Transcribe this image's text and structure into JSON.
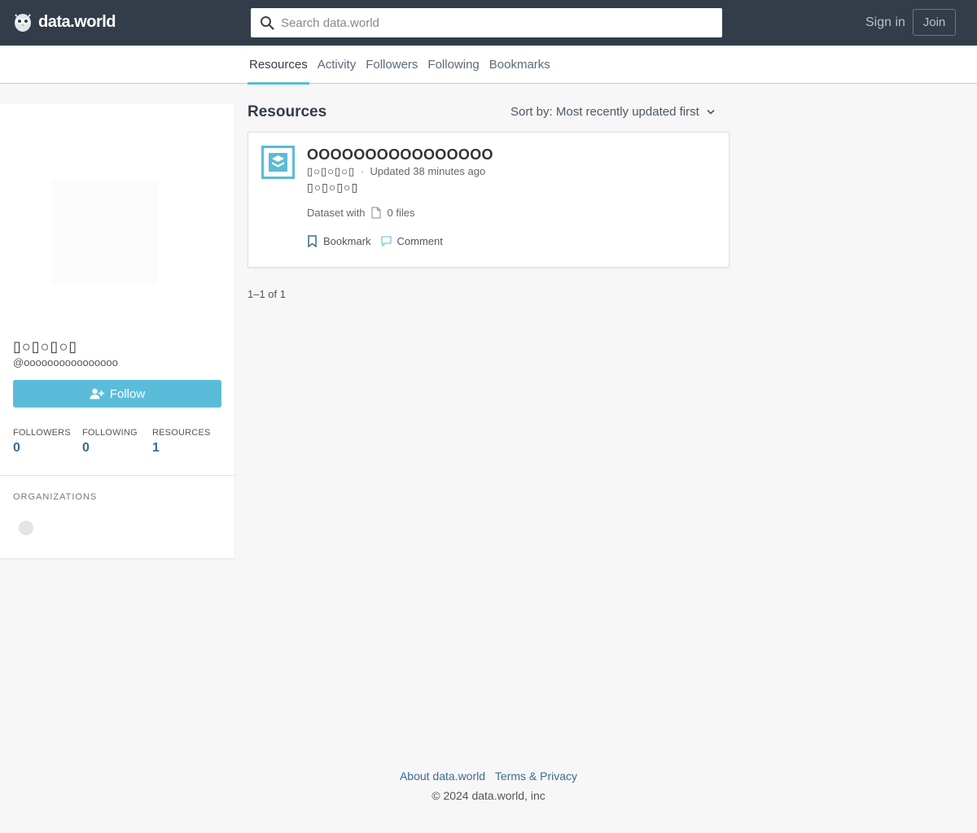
{
  "header": {
    "brand": "data.world",
    "search_placeholder": "Search data.world",
    "signin_label": "Sign in",
    "join_label": "Join"
  },
  "tabs": [
    {
      "label": "Resources",
      "active": true
    },
    {
      "label": "Activity",
      "active": false
    },
    {
      "label": "Followers",
      "active": false
    },
    {
      "label": "Following",
      "active": false
    },
    {
      "label": "Bookmarks",
      "active": false
    }
  ],
  "profile": {
    "display_name": "▯○▯○▯○▯",
    "username": "@oooooooooooooooo",
    "follow_label": "Follow",
    "stats": [
      {
        "label": "FOLLOWERS",
        "value": "0"
      },
      {
        "label": "FOLLOWING",
        "value": "0"
      },
      {
        "label": "RESOURCES",
        "value": "1"
      }
    ],
    "organizations_label": "ORGANIZATIONS"
  },
  "main": {
    "title": "Resources",
    "sort_label": "Sort by: Most recently updated first",
    "card": {
      "title": "OOOOOOOOOOOOOOOO",
      "owner": "▯○▯○▯○▯",
      "separator": "·",
      "updated": "Updated 38 minutes ago",
      "description": "▯○▯○▯○▯",
      "files_prefix": "Dataset with",
      "files_count": "0 files",
      "bookmark_label": "Bookmark",
      "comment_label": "Comment"
    },
    "pagination": "1–1 of 1"
  },
  "footer": {
    "about": "About data.world",
    "terms": "Terms & Privacy",
    "copyright": "© 2024 data.world, inc"
  },
  "colors": {
    "header_bg": "#333d4a",
    "accent": "#5bbcd9",
    "link": "#3a6c93"
  },
  "icons": [
    "owl-logo-icon",
    "search-icon",
    "add-user-icon",
    "chevron-down-icon",
    "dataset-icon",
    "file-icon",
    "bookmark-icon",
    "comment-icon"
  ]
}
